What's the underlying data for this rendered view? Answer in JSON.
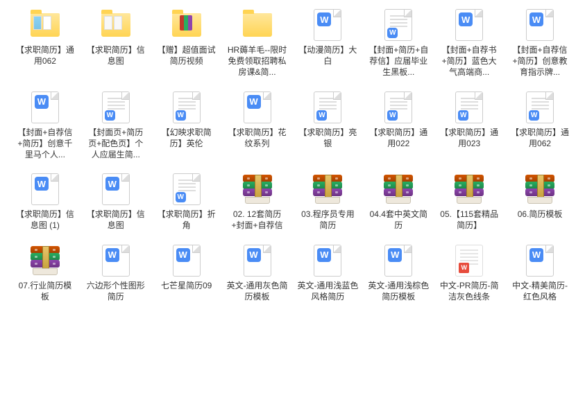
{
  "files": [
    {
      "icon": "folder-1",
      "label": "【求职简历】通用062"
    },
    {
      "icon": "folder-2",
      "label": "【求职简历】信息图"
    },
    {
      "icon": "folder-3",
      "label": "【赠】超值面试简历视频"
    },
    {
      "icon": "folder-4",
      "label": "HR薅羊毛--限时免费领取招聘私房课&简..."
    },
    {
      "icon": "word-big",
      "label": "【动漫简历】大白"
    },
    {
      "icon": "word-small",
      "label": "【封面+简历+自荐信】应届毕业生黑板..."
    },
    {
      "icon": "word-big",
      "label": "【封面+自荐书+简历】蓝色大气高端商..."
    },
    {
      "icon": "word-big",
      "label": "【封面+自荐信+简历】创意教育指示牌..."
    },
    {
      "icon": "word-big",
      "label": "【封面+自荐信+简历】创意千里马个人..."
    },
    {
      "icon": "word-small",
      "label": "【封面页+简历页+配色页】个人应届生简..."
    },
    {
      "icon": "word-small",
      "label": "【幻映求职简历】英伦"
    },
    {
      "icon": "word-big",
      "label": "【求职简历】花纹系列"
    },
    {
      "icon": "word-small",
      "label": "【求职简历】亮银"
    },
    {
      "icon": "word-small",
      "label": "【求职简历】通用022"
    },
    {
      "icon": "word-small",
      "label": "【求职简历】通用023"
    },
    {
      "icon": "word-small",
      "label": "【求职简历】通用062"
    },
    {
      "icon": "word-big",
      "label": "【求职简历】信息图 (1)"
    },
    {
      "icon": "word-big",
      "label": "【求职简历】信息图"
    },
    {
      "icon": "word-small",
      "label": "【求职简历】折角"
    },
    {
      "icon": "rar",
      "label": "02. 12套简历+封面+自荐信"
    },
    {
      "icon": "rar",
      "label": "03.程序员专用简历"
    },
    {
      "icon": "rar",
      "label": "04.4套中英文简历"
    },
    {
      "icon": "rar",
      "label": "05.【115套精品简历】"
    },
    {
      "icon": "rar",
      "label": "06.简历模板"
    },
    {
      "icon": "rar",
      "label": "07.行业简历模板"
    },
    {
      "icon": "word-big",
      "label": "六边形个性图形简历"
    },
    {
      "icon": "word-big",
      "label": "七芒星简历09"
    },
    {
      "icon": "word-big",
      "label": "英文-通用灰色简历模板"
    },
    {
      "icon": "word-big",
      "label": "英文-通用浅蓝色风格简历"
    },
    {
      "icon": "word-big",
      "label": "英文-通用浅棕色简历模板"
    },
    {
      "icon": "wps",
      "label": "中文-PR简历-简洁灰色线条"
    },
    {
      "icon": "word-big",
      "label": "中文-精美简历-红色风格"
    }
  ]
}
